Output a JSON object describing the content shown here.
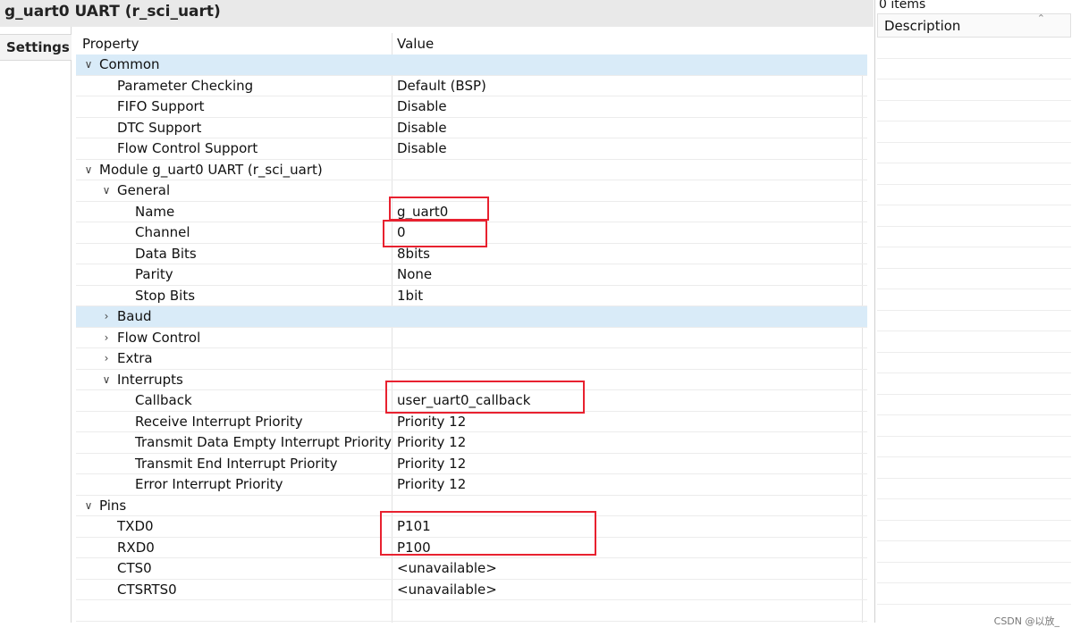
{
  "window": {
    "title": "g_uart0 UART (r_sci_uart)"
  },
  "tabs": {
    "settings": "Settings"
  },
  "grid": {
    "header_property": "Property",
    "header_value": "Value",
    "rows": [
      {
        "label": "Common",
        "value": "",
        "chevron": "down",
        "level": 0,
        "selected": true
      },
      {
        "label": "Parameter Checking",
        "value": "Default (BSP)",
        "chevron": "",
        "level": 1
      },
      {
        "label": "FIFO Support",
        "value": "Disable",
        "chevron": "",
        "level": 1
      },
      {
        "label": "DTC Support",
        "value": "Disable",
        "chevron": "",
        "level": 1
      },
      {
        "label": "Flow Control Support",
        "value": "Disable",
        "chevron": "",
        "level": 1
      },
      {
        "label": "Module g_uart0 UART (r_sci_uart)",
        "value": "",
        "chevron": "down",
        "level": 0
      },
      {
        "label": "General",
        "value": "",
        "chevron": "down",
        "level": 1
      },
      {
        "label": "Name",
        "value": "g_uart0",
        "chevron": "",
        "level": 2
      },
      {
        "label": "Channel",
        "value": "0",
        "chevron": "",
        "level": 2
      },
      {
        "label": "Data Bits",
        "value": "8bits",
        "chevron": "",
        "level": 2
      },
      {
        "label": "Parity",
        "value": "None",
        "chevron": "",
        "level": 2
      },
      {
        "label": "Stop Bits",
        "value": "1bit",
        "chevron": "",
        "level": 2
      },
      {
        "label": "Baud",
        "value": "",
        "chevron": "right",
        "level": 1,
        "selected": true
      },
      {
        "label": "Flow Control",
        "value": "",
        "chevron": "right",
        "level": 1
      },
      {
        "label": "Extra",
        "value": "",
        "chevron": "right",
        "level": 1
      },
      {
        "label": "Interrupts",
        "value": "",
        "chevron": "down",
        "level": 1
      },
      {
        "label": "Callback",
        "value": "user_uart0_callback",
        "chevron": "",
        "level": 2
      },
      {
        "label": "Receive Interrupt Priority",
        "value": "Priority 12",
        "chevron": "",
        "level": 2
      },
      {
        "label": "Transmit Data Empty Interrupt Priority",
        "value": "Priority 12",
        "chevron": "",
        "level": 2
      },
      {
        "label": "Transmit End Interrupt Priority",
        "value": "Priority 12",
        "chevron": "",
        "level": 2
      },
      {
        "label": "Error Interrupt Priority",
        "value": "Priority 12",
        "chevron": "",
        "level": 2
      },
      {
        "label": "Pins",
        "value": "",
        "chevron": "down",
        "level": 0
      },
      {
        "label": "TXD0",
        "value": "P101",
        "chevron": "",
        "level": 1
      },
      {
        "label": "RXD0",
        "value": "P100",
        "chevron": "",
        "level": 1
      },
      {
        "label": "CTS0",
        "value": "<unavailable>",
        "chevron": "",
        "level": 1
      },
      {
        "label": "CTSRTS0",
        "value": "<unavailable>",
        "chevron": "",
        "level": 1
      }
    ]
  },
  "description_panel": {
    "items_count": "0 items",
    "header": "Description"
  },
  "watermark": "CSDN @以放_",
  "colors": {
    "highlight_box": "#e8212f",
    "selected_row": "#d9ebf8"
  }
}
